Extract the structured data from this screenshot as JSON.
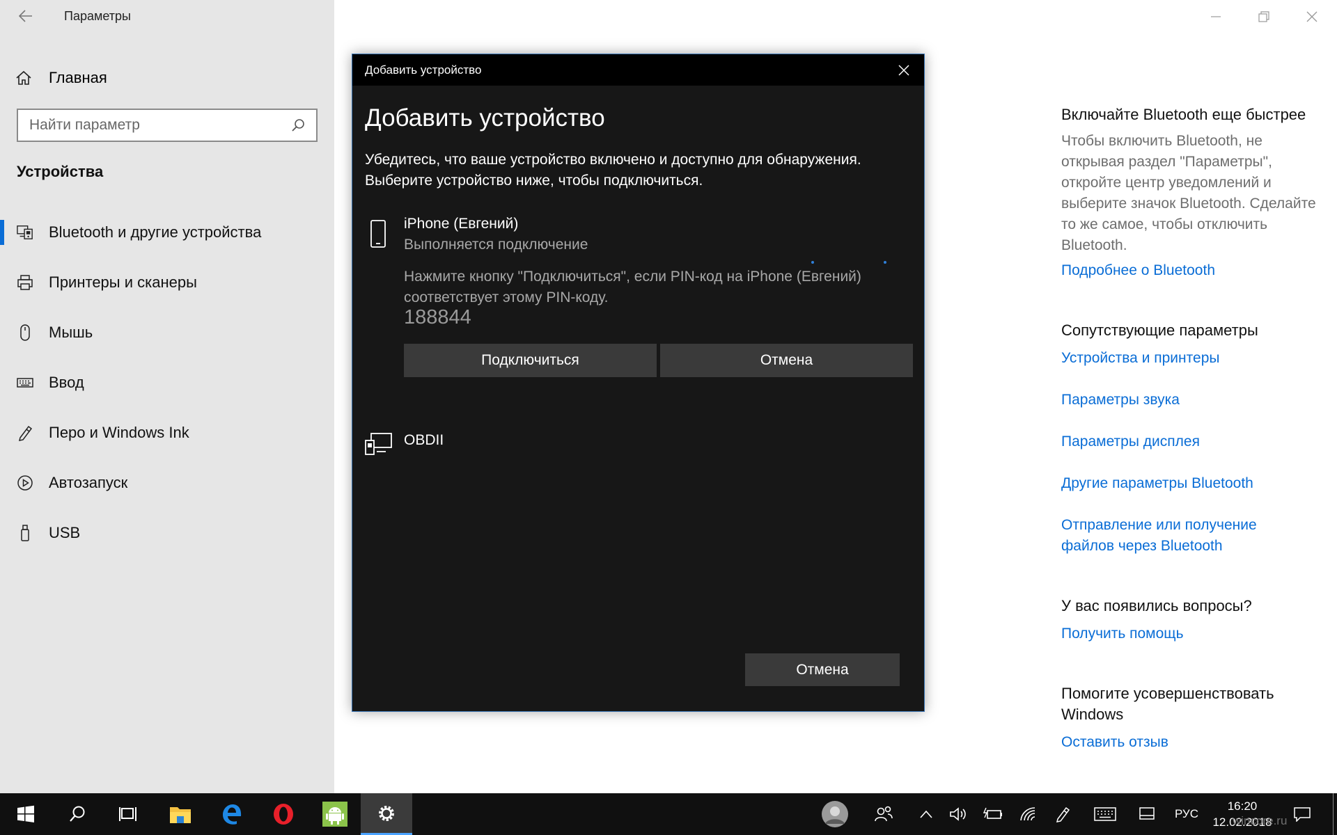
{
  "window": {
    "app_title": "Параметры"
  },
  "sidebar": {
    "home_label": "Главная",
    "search_placeholder": "Найти параметр",
    "section_title": "Устройства",
    "items": [
      {
        "label": "Bluetooth и другие устройства",
        "icon": "bluetooth-devices-icon",
        "active": true
      },
      {
        "label": "Принтеры и сканеры",
        "icon": "printer-icon",
        "active": false
      },
      {
        "label": "Мышь",
        "icon": "mouse-icon",
        "active": false
      },
      {
        "label": "Ввод",
        "icon": "keyboard-icon",
        "active": false
      },
      {
        "label": "Перо и Windows Ink",
        "icon": "pen-icon",
        "active": false
      },
      {
        "label": "Автозапуск",
        "icon": "autoplay-icon",
        "active": false
      },
      {
        "label": "USB",
        "icon": "usb-icon",
        "active": false
      }
    ]
  },
  "help": {
    "quick_title": "Включайте Bluetooth еще быстрее",
    "quick_text": "Чтобы включить Bluetooth, не открывая раздел \"Параметры\", откройте центр уведомлений и выберите значок Bluetooth. Сделайте то же самое, чтобы отключить Bluetooth.",
    "quick_link": "Подробнее о Bluetooth",
    "related_title": "Сопутствующие параметры",
    "related_links": [
      "Устройства и принтеры",
      "Параметры звука",
      "Параметры дисплея",
      "Другие параметры Bluetooth",
      "Отправление или получение файлов через Bluetooth"
    ],
    "questions_title": "У вас появились вопросы?",
    "questions_link": "Получить помощь",
    "improve_title": "Помогите усовершенствовать Windows",
    "improve_link": "Оставить отзыв"
  },
  "dialog": {
    "titlebar": "Добавить устройство",
    "heading": "Добавить устройство",
    "description": "Убедитесь, что ваше устройство включено и доступно для обнаружения. Выберите устройство ниже, чтобы подключиться.",
    "devices": [
      {
        "name": "iPhone (Евгений)",
        "status": "Выполняется подключение",
        "prompt": "Нажмите кнопку \"Подключиться\", если PIN-код на iPhone (Евгений) соответствует этому PIN-коду.",
        "pin": "188844",
        "connect_label": "Подключиться",
        "cancel_label": "Отмена",
        "icon": "phone-icon"
      },
      {
        "name": "OBDII",
        "icon": "generic-device-icon"
      }
    ],
    "cancel_label": "Отмена"
  },
  "taskbar": {
    "apps": [
      "start-icon",
      "search-icon",
      "task-view-icon",
      "file-explorer-icon",
      "edge-icon",
      "opera-icon",
      "android-icon",
      "settings-icon"
    ],
    "language": "РУС",
    "time": "16:20",
    "date": "12.02.2018",
    "watermark": "wincore.ru"
  },
  "colors": {
    "accent": "#0a6dd6",
    "sidebar_bg": "#e6e6e6",
    "dialog_bg": "#171717",
    "taskbar_bg": "#101010"
  }
}
